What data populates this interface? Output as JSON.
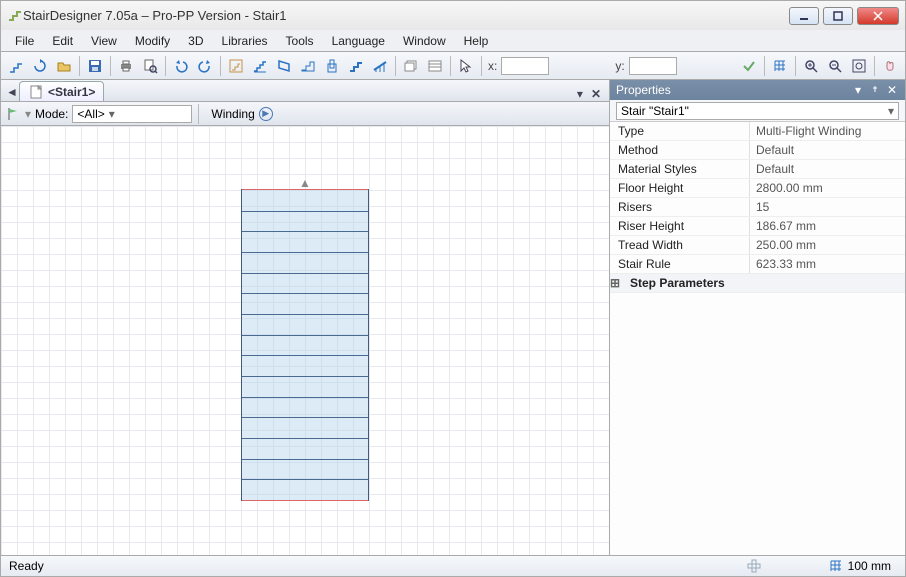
{
  "window": {
    "title": "StairDesigner 7.05a – Pro-PP Version - Stair1"
  },
  "menu": [
    "File",
    "Edit",
    "View",
    "Modify",
    "3D",
    "Libraries",
    "Tools",
    "Language",
    "Window",
    "Help"
  ],
  "toolbar": {
    "xlabel": "x:",
    "ylabel": "y:",
    "xval": "",
    "yval": ""
  },
  "tabs": {
    "active": "<Stair1>"
  },
  "mode": {
    "label": "Mode:",
    "value": "<All>",
    "winding_label": "Winding"
  },
  "properties": {
    "panel_title": "Properties",
    "object": "Stair \"Stair1\"",
    "rows": [
      {
        "k": "Type",
        "v": "Multi-Flight Winding"
      },
      {
        "k": "Method",
        "v": "Default"
      },
      {
        "k": "Material Styles",
        "v": "Default"
      },
      {
        "k": "Floor Height",
        "v": "2800.00 mm"
      },
      {
        "k": "Risers",
        "v": "15"
      },
      {
        "k": "Riser Height",
        "v": "186.67 mm"
      },
      {
        "k": "Tread Width",
        "v": "250.00 mm"
      },
      {
        "k": "Stair Rule",
        "v": "623.33 mm"
      }
    ],
    "group": "Step Parameters"
  },
  "status": {
    "text": "Ready",
    "grid": "100 mm"
  }
}
